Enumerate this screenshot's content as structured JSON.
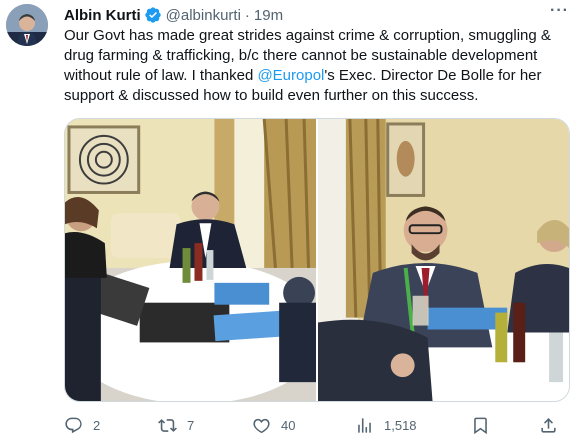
{
  "tweet": {
    "author_name": "Albin Kurti",
    "handle": "@albinkurti",
    "separator": "·",
    "time": "19m",
    "text_part1": "Our Govt has made great strides against crime & corruption, smuggling & drug farming & trafficking, b/c there cannot be sustainable development without rule of law. I thanked ",
    "mention": "@Europol",
    "text_part2": "'s Exec. Director De Bolle for her support & discussed how to build even further on this success."
  },
  "actions": {
    "replies": "2",
    "retweets": "7",
    "likes": "40",
    "views": "1,518"
  },
  "colors": {
    "accent": "#1d9bf0",
    "muted": "#536471"
  },
  "icons": [
    "verified-badge-icon",
    "more-icon",
    "reply-icon",
    "retweet-icon",
    "like-icon",
    "views-icon",
    "share-icon"
  ]
}
